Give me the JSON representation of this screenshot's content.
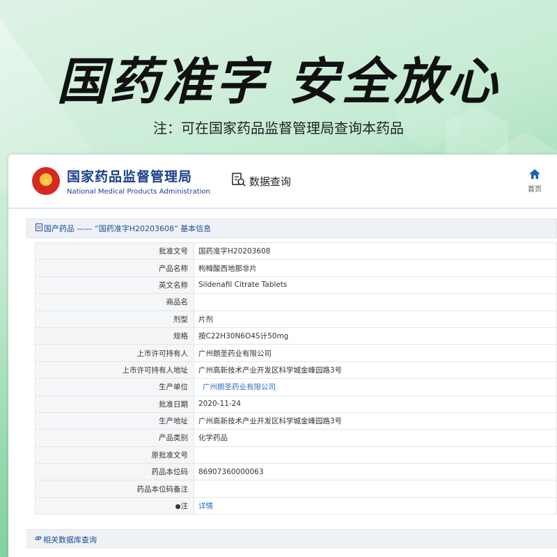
{
  "banner": {
    "headline": "国药准字 安全放心",
    "note": "注：可在国家药品监督管理局查询本药品"
  },
  "site": {
    "name_cn": "国家药品监督管理局",
    "name_en": "National Medical Products Administration",
    "query_label": "数据查询",
    "home_label": "首页"
  },
  "section": {
    "title": "国产药品 —— “国药准字H20203608” 基本信息"
  },
  "rows": [
    {
      "label": "批准文号",
      "value": "国药准字H20203608"
    },
    {
      "label": "产品名称",
      "value": "枸橼酸西地那非片"
    },
    {
      "label": "英文名称",
      "value": "Sildenafil Citrate Tablets"
    },
    {
      "label": "商品名",
      "value": ""
    },
    {
      "label": "剂型",
      "value": "片剂"
    },
    {
      "label": "规格",
      "value": "按C22H30N6O4S计50mg"
    },
    {
      "label": "上市许可持有人",
      "value": "广州朗圣药业有限公司"
    },
    {
      "label": "上市许可持有人地址",
      "value": "广州高新技术产业开发区科学城金峰园路3号"
    },
    {
      "label": "生产单位",
      "value": "广州朗圣药业有限公司"
    },
    {
      "label": "批准日期",
      "value": "2020-11-24"
    },
    {
      "label": "生产地址",
      "value": "广州高新技术产业开发区科学城金峰园路3号"
    },
    {
      "label": "产品类别",
      "value": "化学药品"
    },
    {
      "label": "原批准文号",
      "value": ""
    },
    {
      "label": "药品本位码",
      "value": "86907360000063"
    },
    {
      "label": "药品本位码备注",
      "value": ""
    },
    {
      "label": "注",
      "value": "详情"
    }
  ],
  "related": {
    "label": "相关数据库查询"
  }
}
